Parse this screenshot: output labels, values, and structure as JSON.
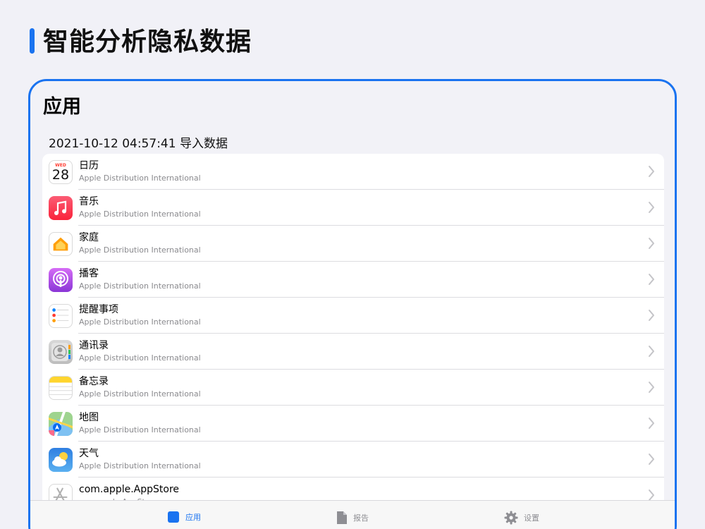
{
  "page_title": "智能分析隐私数据",
  "section_title": "应用",
  "import_info": "2021-10-12 04:57:41 导入数据",
  "colors": {
    "accent": "#1a73f0",
    "background": "#f1f1f7"
  },
  "apps": [
    {
      "name": "日历",
      "developer": "Apple Distribution International",
      "icon": "calendar-icon",
      "calendar_weekday": "WED",
      "calendar_day": "28"
    },
    {
      "name": "音乐",
      "developer": "Apple Distribution International",
      "icon": "music-icon"
    },
    {
      "name": "家庭",
      "developer": "Apple Distribution International",
      "icon": "home-icon"
    },
    {
      "name": "播客",
      "developer": "Apple Distribution International",
      "icon": "podcasts-icon"
    },
    {
      "name": "提醒事项",
      "developer": "Apple Distribution International",
      "icon": "reminders-icon"
    },
    {
      "name": "通讯录",
      "developer": "Apple Distribution International",
      "icon": "contacts-icon"
    },
    {
      "name": "备忘录",
      "developer": "Apple Distribution International",
      "icon": "notes-icon"
    },
    {
      "name": "地图",
      "developer": "Apple Distribution International",
      "icon": "maps-icon"
    },
    {
      "name": "天气",
      "developer": "Apple Distribution International",
      "icon": "weather-icon"
    },
    {
      "name": "com.apple.AppStore",
      "developer": "com.apple.AppStore",
      "icon": "app-store-icon"
    }
  ],
  "tabbar": {
    "tabs": [
      {
        "label": "应用",
        "icon": "apps-square-icon",
        "active": true
      },
      {
        "label": "报告",
        "icon": "document-icon",
        "active": false
      },
      {
        "label": "设置",
        "icon": "gear-icon",
        "active": false
      }
    ]
  }
}
